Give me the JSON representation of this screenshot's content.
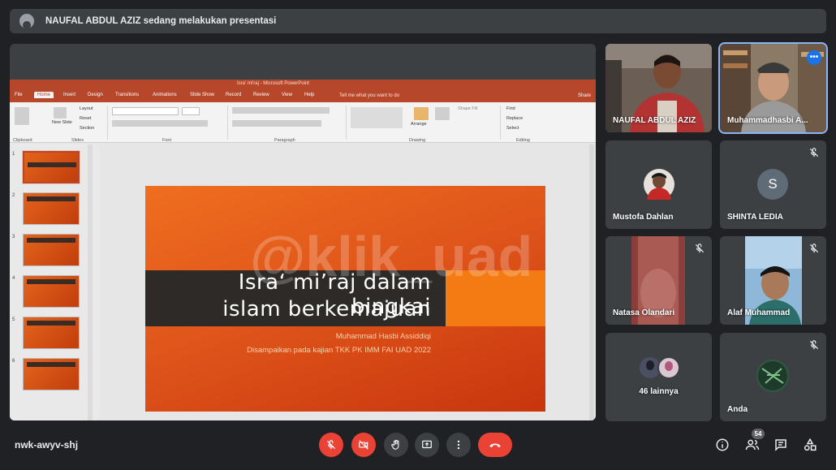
{
  "banner": {
    "text": "NAUFAL ABDUL AZIZ sedang melakukan presentasi"
  },
  "presentation": {
    "window_title": "Isra' mi'raj - Microsoft PowerPoint",
    "tabs": [
      "File",
      "Home",
      "Insert",
      "Design",
      "Transitions",
      "Animations",
      "Slide Show",
      "Record",
      "Review",
      "View",
      "Help"
    ],
    "tell_me": "Tell me what you want to do",
    "share": "Share",
    "ribbon_groups": [
      "Clipboard",
      "Slides",
      "Font",
      "Paragraph",
      "Drawing",
      "Editing"
    ],
    "ribbon_labels": {
      "new_slide": "New Slide",
      "layout": "Layout",
      "reset": "Reset",
      "section": "Section",
      "arrange": "Arrange",
      "find": "Find",
      "replace": "Replace",
      "select": "Select",
      "shape_fill": "Shape Fill"
    },
    "thumb_numbers": [
      "1",
      "2",
      "3",
      "4",
      "5",
      "6"
    ],
    "slide": {
      "title_line1": "Isra‘ mi’raj dalam bingkai",
      "title_line2": "islam berkemajuan",
      "subtitle_line1": "Muhammad Hasbi Assiddiqi",
      "subtitle_line2": "Disampaikan pada kajian TKK PK IMM FAI UAD 2022"
    },
    "watermark": "@klik_uad",
    "colors": {
      "accent": "#b7472a",
      "slide_orange": "#e0561b",
      "band": "#2e2a27"
    }
  },
  "participants": [
    {
      "name": "NAUFAL ABDUL AZIZ",
      "muted": false,
      "has_video": true
    },
    {
      "name": "Muhammadhasbi A...",
      "muted": false,
      "has_video": true,
      "speaking": true
    },
    {
      "name": "Mustofa Dahlan",
      "muted": false,
      "has_video": false
    },
    {
      "name": "SHINTA LEDIA",
      "initial": "S",
      "muted": true,
      "has_video": false
    },
    {
      "name": "Natasa Olandari",
      "muted": true,
      "has_video": true
    },
    {
      "name": "Alaf Muhammad",
      "muted": true,
      "has_video": true
    },
    {
      "name": "46 lainnya",
      "muted": false,
      "has_video": false
    },
    {
      "name": "Anda",
      "muted": true,
      "has_video": false
    }
  ],
  "bottom_bar": {
    "meeting_code": "nwk-awyv-shj",
    "participant_count": "54",
    "colors": {
      "danger": "#ea4335",
      "control_bg": "#3c4043"
    }
  }
}
